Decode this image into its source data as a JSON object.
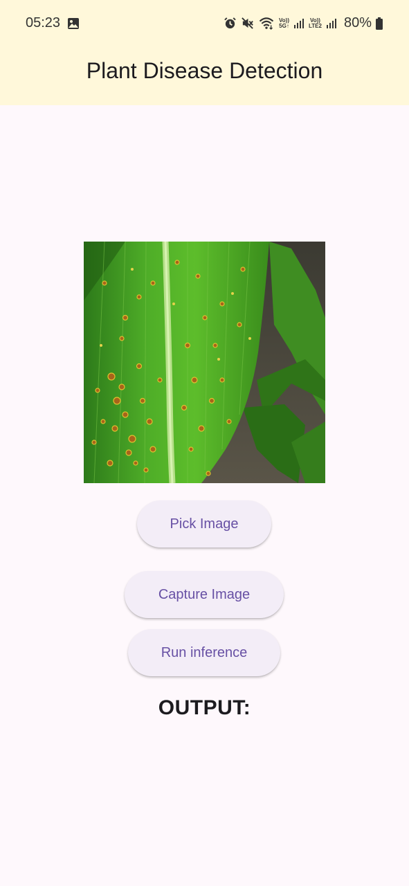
{
  "status_bar": {
    "time": "05:23",
    "network_1_top": "Vo))",
    "network_1_bottom": "5G↑",
    "network_2_top": "Vo))",
    "network_2_bottom": "LTE2",
    "battery": "80%"
  },
  "app_bar": {
    "title": "Plant Disease Detection"
  },
  "main": {
    "image_alt": "corn leaf with rust spots",
    "pick_label": "Pick Image",
    "capture_label": "Capture Image",
    "run_label": "Run inference",
    "output_label": "OUTPUT:"
  },
  "colors": {
    "app_bar_bg": "#FFF8DA",
    "page_bg": "#FEF8FC",
    "button_bg": "#F3EDF7",
    "button_text": "#6750A4"
  }
}
